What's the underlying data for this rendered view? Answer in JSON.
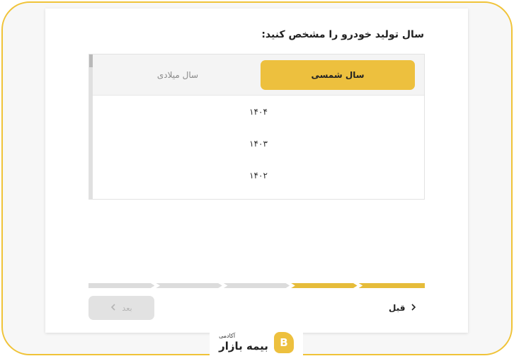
{
  "question": "سال تولید خودرو را مشخص کنید:",
  "tabs": [
    {
      "label": "سال شمسی",
      "active": true
    },
    {
      "label": "سال میلادی",
      "active": false
    }
  ],
  "years": [
    "۱۴۰۴",
    "۱۴۰۳",
    "۱۴۰۲"
  ],
  "progress": {
    "total_steps": 5,
    "completed_steps": 2
  },
  "nav": {
    "next_label": "بعد",
    "prev_label": "قبل"
  },
  "logo": {
    "subtitle": "آکادمی",
    "brand": "بیمه بازار",
    "badge_letter": "B"
  },
  "colors": {
    "accent": "#edc03e",
    "frame_border": "#f0c338",
    "disabled": "#e2e2e2"
  }
}
